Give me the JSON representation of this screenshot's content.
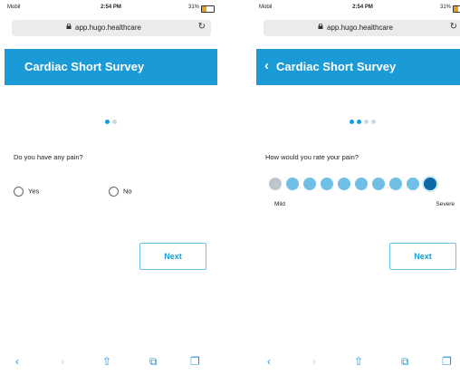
{
  "status_bar": {
    "carrier": "Mobil",
    "time": "2:54 PM",
    "battery": "31%"
  },
  "browser": {
    "url": "app.hugo.healthcare",
    "reload_icon": "reload-icon"
  },
  "colors": {
    "brand": "#1a9ad6",
    "scale_gray": "#bfc6cb"
  },
  "left_screen": {
    "header_title": "Cardiac Short Survey",
    "progress": {
      "current": 1,
      "total": 2
    },
    "question": "Do you have any pain?",
    "options": [
      "Yes",
      "No"
    ],
    "next_label": "Next"
  },
  "right_screen": {
    "header_title": "Cardiac Short Survey",
    "back_icon": "back-chevron-icon",
    "progress": {
      "current": 2,
      "total": 4
    },
    "question": "How would you rate your pain?",
    "scale": {
      "min": 1,
      "max": 10,
      "selected": 10,
      "min_label": "Mild",
      "max_label": "Severe"
    },
    "next_label": "Next"
  }
}
